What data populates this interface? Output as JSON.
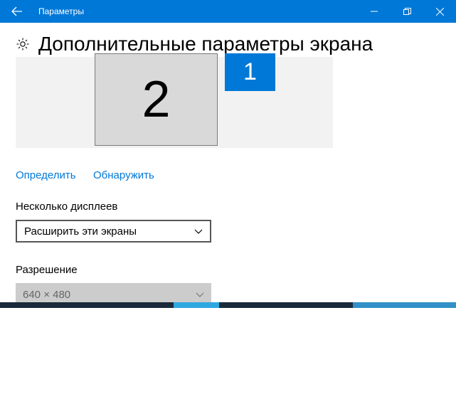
{
  "titlebar": {
    "title": "Параметры"
  },
  "page": {
    "title": "Дополнительные параметры экрана"
  },
  "monitors": {
    "primary": "1",
    "secondary": "2"
  },
  "links": {
    "identify": "Определить",
    "detect": "Обнаружить"
  },
  "multi_display": {
    "label": "Несколько дисплеев",
    "value": "Расширить эти экраны"
  },
  "resolution": {
    "label": "Разрешение",
    "value": "640 × 480"
  },
  "colors": {
    "accent": "#0078d7"
  }
}
